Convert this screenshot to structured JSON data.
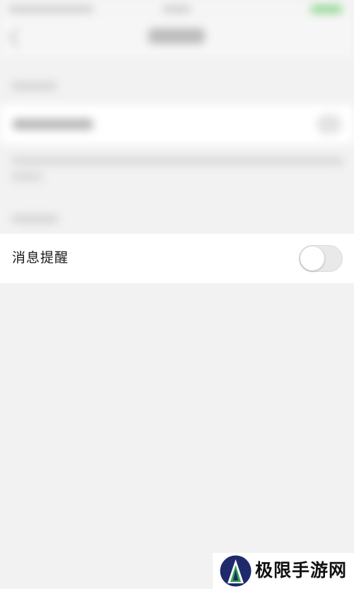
{
  "settings": {
    "message_reminder_label": "消息提醒",
    "message_reminder_enabled": false
  },
  "watermark": {
    "text": "极限手游网"
  },
  "colors": {
    "background": "#f2f2f2",
    "toggle_off": "#e9e9e9",
    "logo_blue": "#1f2a6b",
    "logo_green": "#2fa84f"
  }
}
